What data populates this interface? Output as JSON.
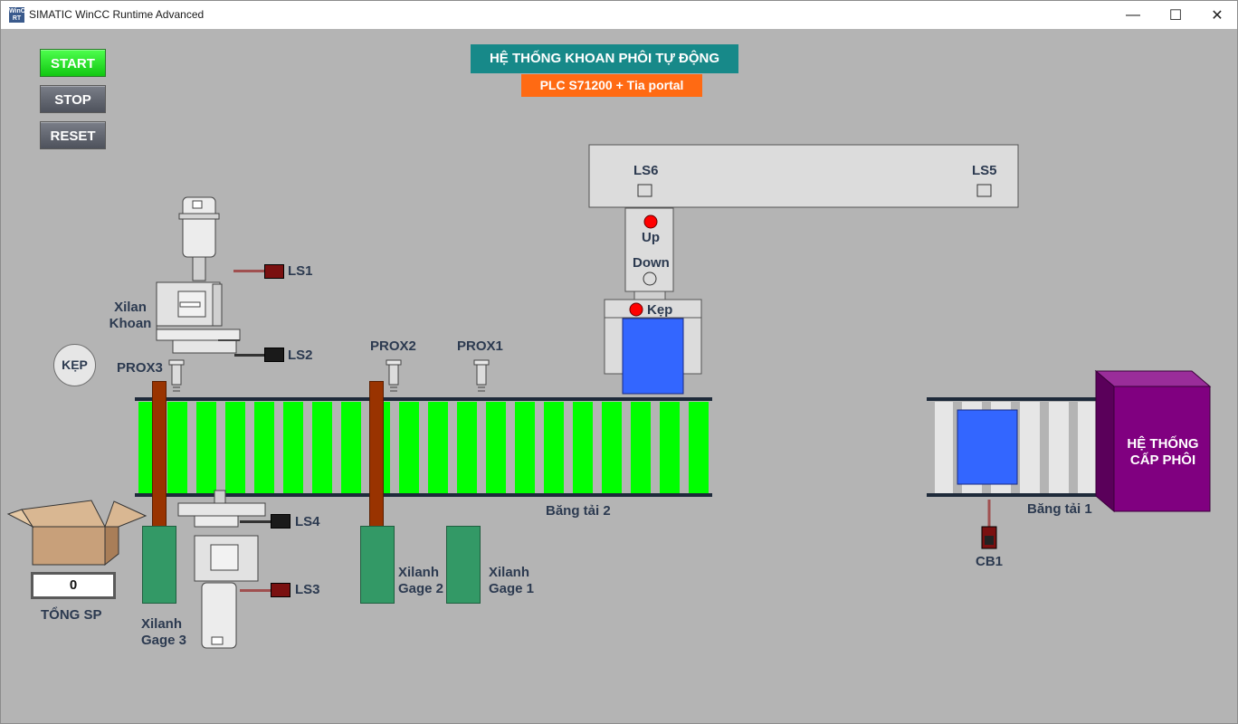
{
  "window": {
    "title": "SIMATIC WinCC Runtime Advanced",
    "app_icon_text": "WinCC RT",
    "controls": {
      "minimize": "—",
      "maximize": "☐",
      "close": "✕"
    }
  },
  "header": {
    "title": "HỆ THỐNG KHOAN PHÔI TỰ ĐỘNG",
    "subtitle": "PLC S71200 + Tia portal"
  },
  "buttons": {
    "start": "START",
    "stop": "STOP",
    "reset": "RESET"
  },
  "kep_button": "KẸP",
  "counter": {
    "value": "0",
    "label": "TỔNG SP"
  },
  "drill": {
    "label_line1": "Xilan",
    "label_line2": "Khoan"
  },
  "sensors": {
    "ls1": "LS1",
    "ls2": "LS2",
    "ls3": "LS3",
    "ls4": "LS4",
    "ls5": "LS5",
    "ls6": "LS6",
    "prox1": "PROX1",
    "prox2": "PROX2",
    "prox3": "PROX3",
    "cb1": "CB1"
  },
  "gages": {
    "gage1": {
      "line1": "Xilanh",
      "line2": "Gage 1"
    },
    "gage2": {
      "line1": "Xilanh",
      "line2": "Gage 2"
    },
    "gage3": {
      "line1": "Xilanh",
      "line2": "Gage 3"
    }
  },
  "conveyors": {
    "belt2": "Băng tải 2",
    "belt1": "Băng tải 1"
  },
  "gantry": {
    "up": "Up",
    "down": "Down",
    "clamp": "Kẹp"
  },
  "feeder": {
    "line1": "HỆ THỐNG",
    "line2": "CẤP PHÔI"
  },
  "colors": {
    "background": "#b4b4b4",
    "belt2_stripe": "#00ff00",
    "belt1_stripe": "#e6e6e6",
    "workpiece": "#3366ff",
    "gage": "#339966",
    "rod": "#993300",
    "feeder": "#800080",
    "indicator_on": "#ff0000",
    "title_bg": "#178989",
    "subtitle_bg": "#ff6a13",
    "start_button": "#22dd22"
  }
}
